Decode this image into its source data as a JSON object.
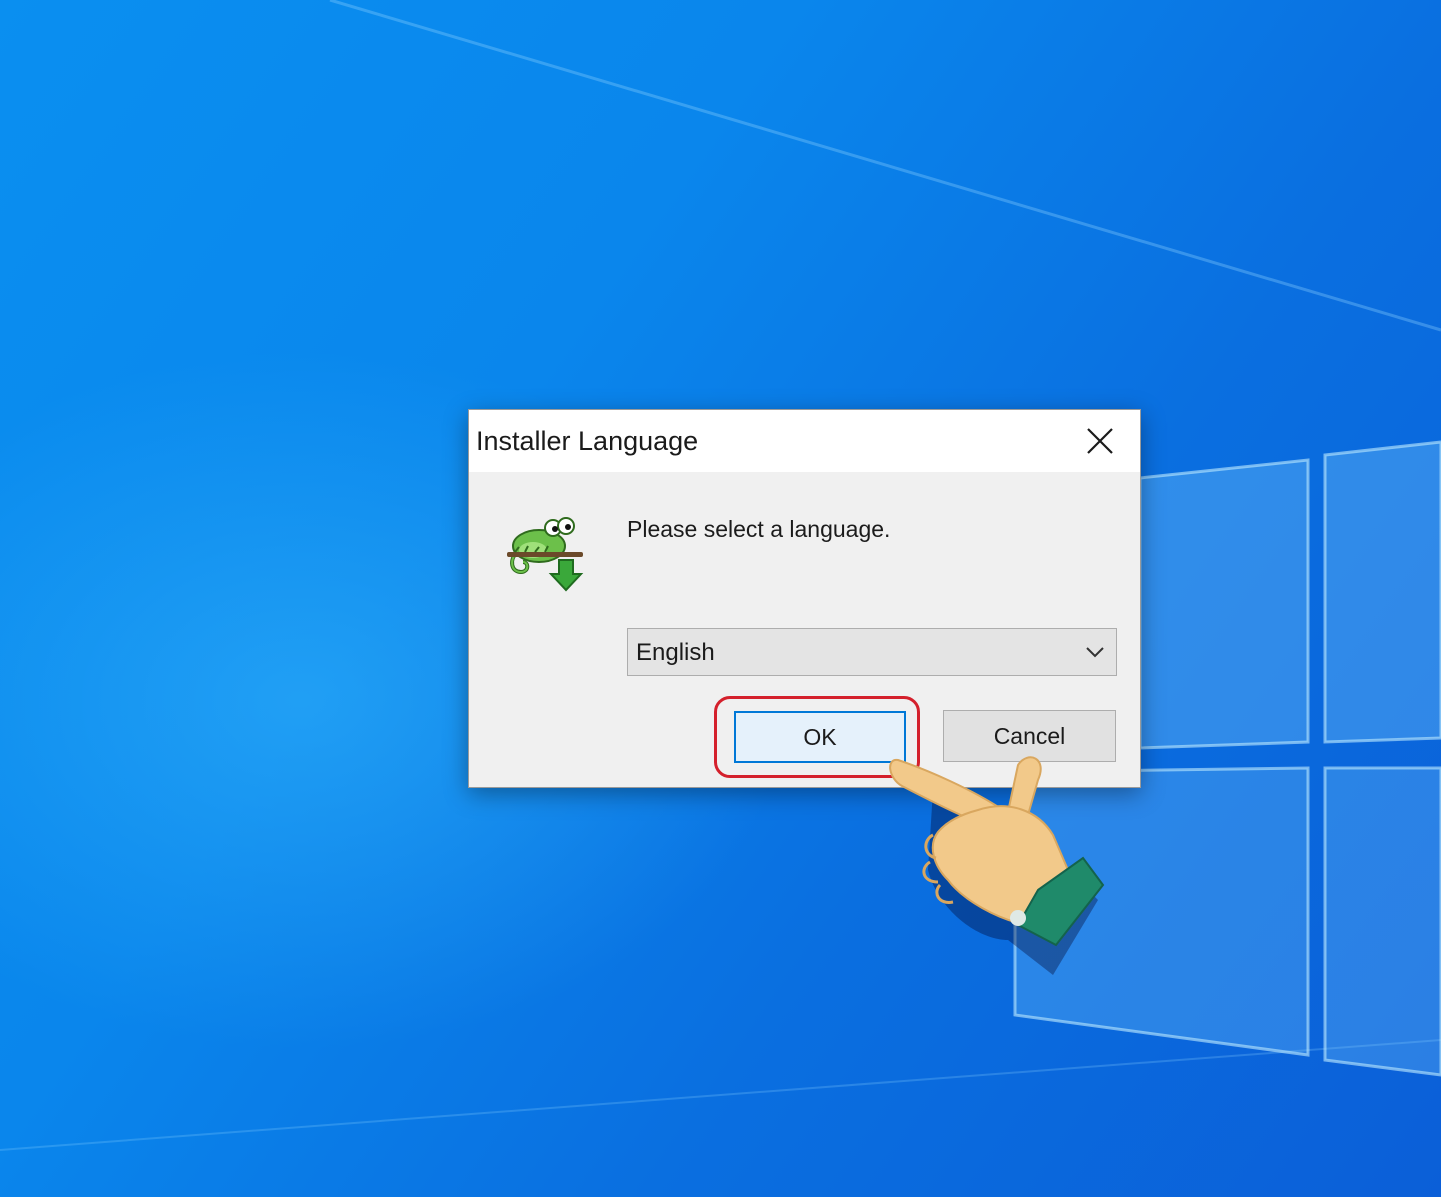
{
  "dialog": {
    "title": "Installer Language",
    "prompt": "Please select a language.",
    "language_select": {
      "selected": "English"
    },
    "buttons": {
      "ok": "OK",
      "cancel": "Cancel"
    }
  },
  "icons": {
    "app": "notepad-plus-plus-chameleon-icon",
    "close": "close-icon",
    "dropdown": "chevron-down-icon",
    "pointer": "pointing-hand-icon"
  },
  "colors": {
    "desktop_blue": "#0a86ec",
    "dialog_bg": "#f0f0f0",
    "focus_blue": "#0078d7",
    "highlight_red": "#d4202c"
  }
}
